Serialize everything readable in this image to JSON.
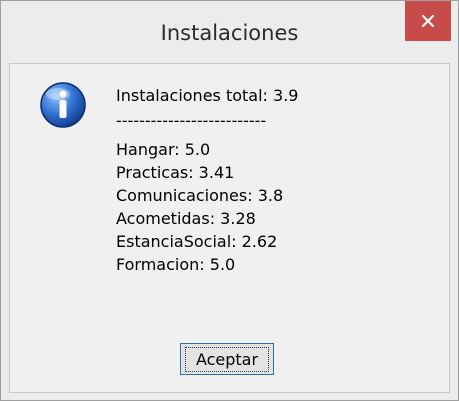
{
  "window": {
    "title": "Instalaciones"
  },
  "icons": {
    "close": "close-icon",
    "info": "info-icon"
  },
  "message": {
    "total": "Instalaciones total: 3.9",
    "separator": "--------------------------",
    "items": [
      "Hangar: 5.0",
      "Practicas: 3.41",
      "Comunicaciones: 3.8",
      "Acometidas: 3.28",
      "EstanciaSocial: 2.62",
      "Formacion: 5.0"
    ]
  },
  "buttons": {
    "accept": "Aceptar"
  },
  "colors": {
    "close_bg": "#c64b49",
    "accent": "#2f6fb0"
  }
}
